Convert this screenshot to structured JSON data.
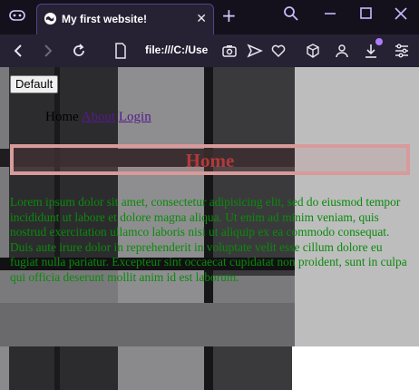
{
  "browser": {
    "tab_title": "My first website!",
    "tab_close": "✕",
    "new_tab": "+",
    "url": "file:///C:/Use",
    "icons": [
      "gamepad-icon",
      "globe-icon",
      "search-icon",
      "minimize-icon",
      "maximize-icon",
      "close-icon",
      "back-icon",
      "forward-icon",
      "reload-icon",
      "page-icon",
      "camera-icon",
      "send-icon",
      "heart-icon",
      "cube-icon",
      "profile-icon",
      "download-icon",
      "settings-icon"
    ],
    "accent": "#b07cff"
  },
  "page": {
    "default_button": "Default",
    "menu": {
      "home": "Home",
      "about": "About",
      "login": "Login"
    },
    "heading": "Home",
    "paragraph": "Lorem ipsum dolor sit amet, consectetur adipisicing elit, sed do eiusmod tempor incididunt ut labore et dolore magna aliqua. Ut enim ad minim veniam, quis nostrud exercitation ullamco laboris nisi ut aliquip ex ea commodo consequat. Duis aute irure dolor in reprehenderit in voluptate velit esse cillum dolore eu fugiat nulla pariatur. Excepteur sint occaecat cupidatat non proident, sunt in culpa qui officia deserunt mollit anim id est laborum.",
    "colors": {
      "heading": "#b23a3a",
      "paragraph": "#0a8a0a",
      "link": "#551a8b"
    }
  }
}
